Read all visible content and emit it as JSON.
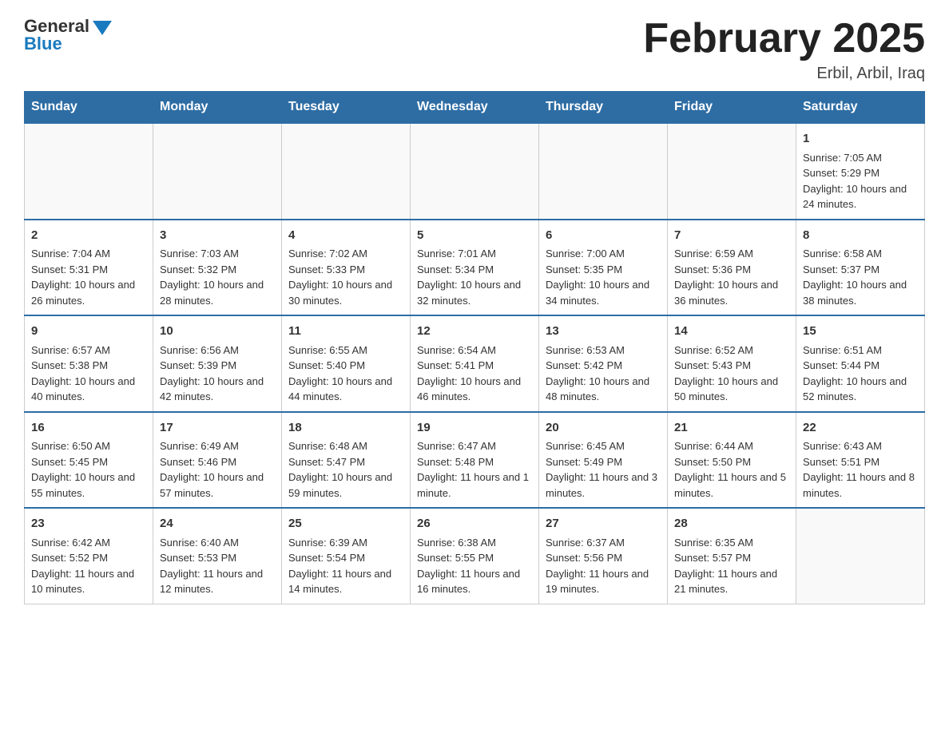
{
  "header": {
    "logo_general": "General",
    "logo_blue": "Blue",
    "month_title": "February 2025",
    "location": "Erbil, Arbil, Iraq"
  },
  "weekdays": [
    "Sunday",
    "Monday",
    "Tuesday",
    "Wednesday",
    "Thursday",
    "Friday",
    "Saturday"
  ],
  "weeks": [
    [
      {
        "day": "",
        "empty": true
      },
      {
        "day": "",
        "empty": true
      },
      {
        "day": "",
        "empty": true
      },
      {
        "day": "",
        "empty": true
      },
      {
        "day": "",
        "empty": true
      },
      {
        "day": "",
        "empty": true
      },
      {
        "day": "1",
        "sunrise": "Sunrise: 7:05 AM",
        "sunset": "Sunset: 5:29 PM",
        "daylight": "Daylight: 10 hours and 24 minutes."
      }
    ],
    [
      {
        "day": "2",
        "sunrise": "Sunrise: 7:04 AM",
        "sunset": "Sunset: 5:31 PM",
        "daylight": "Daylight: 10 hours and 26 minutes."
      },
      {
        "day": "3",
        "sunrise": "Sunrise: 7:03 AM",
        "sunset": "Sunset: 5:32 PM",
        "daylight": "Daylight: 10 hours and 28 minutes."
      },
      {
        "day": "4",
        "sunrise": "Sunrise: 7:02 AM",
        "sunset": "Sunset: 5:33 PM",
        "daylight": "Daylight: 10 hours and 30 minutes."
      },
      {
        "day": "5",
        "sunrise": "Sunrise: 7:01 AM",
        "sunset": "Sunset: 5:34 PM",
        "daylight": "Daylight: 10 hours and 32 minutes."
      },
      {
        "day": "6",
        "sunrise": "Sunrise: 7:00 AM",
        "sunset": "Sunset: 5:35 PM",
        "daylight": "Daylight: 10 hours and 34 minutes."
      },
      {
        "day": "7",
        "sunrise": "Sunrise: 6:59 AM",
        "sunset": "Sunset: 5:36 PM",
        "daylight": "Daylight: 10 hours and 36 minutes."
      },
      {
        "day": "8",
        "sunrise": "Sunrise: 6:58 AM",
        "sunset": "Sunset: 5:37 PM",
        "daylight": "Daylight: 10 hours and 38 minutes."
      }
    ],
    [
      {
        "day": "9",
        "sunrise": "Sunrise: 6:57 AM",
        "sunset": "Sunset: 5:38 PM",
        "daylight": "Daylight: 10 hours and 40 minutes."
      },
      {
        "day": "10",
        "sunrise": "Sunrise: 6:56 AM",
        "sunset": "Sunset: 5:39 PM",
        "daylight": "Daylight: 10 hours and 42 minutes."
      },
      {
        "day": "11",
        "sunrise": "Sunrise: 6:55 AM",
        "sunset": "Sunset: 5:40 PM",
        "daylight": "Daylight: 10 hours and 44 minutes."
      },
      {
        "day": "12",
        "sunrise": "Sunrise: 6:54 AM",
        "sunset": "Sunset: 5:41 PM",
        "daylight": "Daylight: 10 hours and 46 minutes."
      },
      {
        "day": "13",
        "sunrise": "Sunrise: 6:53 AM",
        "sunset": "Sunset: 5:42 PM",
        "daylight": "Daylight: 10 hours and 48 minutes."
      },
      {
        "day": "14",
        "sunrise": "Sunrise: 6:52 AM",
        "sunset": "Sunset: 5:43 PM",
        "daylight": "Daylight: 10 hours and 50 minutes."
      },
      {
        "day": "15",
        "sunrise": "Sunrise: 6:51 AM",
        "sunset": "Sunset: 5:44 PM",
        "daylight": "Daylight: 10 hours and 52 minutes."
      }
    ],
    [
      {
        "day": "16",
        "sunrise": "Sunrise: 6:50 AM",
        "sunset": "Sunset: 5:45 PM",
        "daylight": "Daylight: 10 hours and 55 minutes."
      },
      {
        "day": "17",
        "sunrise": "Sunrise: 6:49 AM",
        "sunset": "Sunset: 5:46 PM",
        "daylight": "Daylight: 10 hours and 57 minutes."
      },
      {
        "day": "18",
        "sunrise": "Sunrise: 6:48 AM",
        "sunset": "Sunset: 5:47 PM",
        "daylight": "Daylight: 10 hours and 59 minutes."
      },
      {
        "day": "19",
        "sunrise": "Sunrise: 6:47 AM",
        "sunset": "Sunset: 5:48 PM",
        "daylight": "Daylight: 11 hours and 1 minute."
      },
      {
        "day": "20",
        "sunrise": "Sunrise: 6:45 AM",
        "sunset": "Sunset: 5:49 PM",
        "daylight": "Daylight: 11 hours and 3 minutes."
      },
      {
        "day": "21",
        "sunrise": "Sunrise: 6:44 AM",
        "sunset": "Sunset: 5:50 PM",
        "daylight": "Daylight: 11 hours and 5 minutes."
      },
      {
        "day": "22",
        "sunrise": "Sunrise: 6:43 AM",
        "sunset": "Sunset: 5:51 PM",
        "daylight": "Daylight: 11 hours and 8 minutes."
      }
    ],
    [
      {
        "day": "23",
        "sunrise": "Sunrise: 6:42 AM",
        "sunset": "Sunset: 5:52 PM",
        "daylight": "Daylight: 11 hours and 10 minutes."
      },
      {
        "day": "24",
        "sunrise": "Sunrise: 6:40 AM",
        "sunset": "Sunset: 5:53 PM",
        "daylight": "Daylight: 11 hours and 12 minutes."
      },
      {
        "day": "25",
        "sunrise": "Sunrise: 6:39 AM",
        "sunset": "Sunset: 5:54 PM",
        "daylight": "Daylight: 11 hours and 14 minutes."
      },
      {
        "day": "26",
        "sunrise": "Sunrise: 6:38 AM",
        "sunset": "Sunset: 5:55 PM",
        "daylight": "Daylight: 11 hours and 16 minutes."
      },
      {
        "day": "27",
        "sunrise": "Sunrise: 6:37 AM",
        "sunset": "Sunset: 5:56 PM",
        "daylight": "Daylight: 11 hours and 19 minutes."
      },
      {
        "day": "28",
        "sunrise": "Sunrise: 6:35 AM",
        "sunset": "Sunset: 5:57 PM",
        "daylight": "Daylight: 11 hours and 21 minutes."
      },
      {
        "day": "",
        "empty": true
      }
    ]
  ]
}
